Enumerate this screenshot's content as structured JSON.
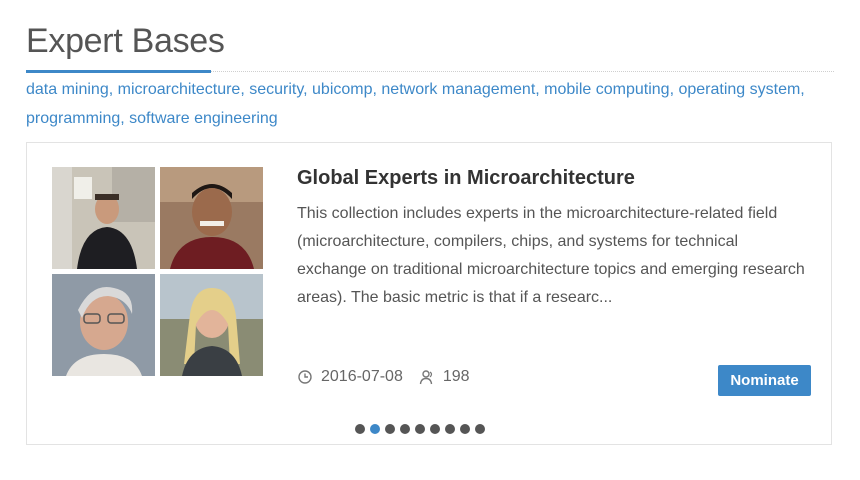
{
  "section": {
    "title": "Expert Bases",
    "tags": [
      "data mining",
      "microarchitecture",
      "security",
      "ubicomp",
      "network management",
      "mobile computing",
      "operating system",
      "programming",
      "software engineering"
    ]
  },
  "card": {
    "title": "Global Experts in Microarchitecture",
    "description": "This collection includes experts in the microarchitecture-related field (microarchitecture, compilers, chips, and systems for technical exchange on traditional microarchitecture topics and emerging research areas). The basic metric is that if a researc...",
    "date": "2016-07-08",
    "member_count": "198",
    "nominate_label": "Nominate",
    "date_icon": "clock-icon",
    "members_icon": "user-icon"
  },
  "carousel": {
    "total": 9,
    "active_index": 1
  },
  "colors": {
    "accent": "#3d88c8"
  }
}
